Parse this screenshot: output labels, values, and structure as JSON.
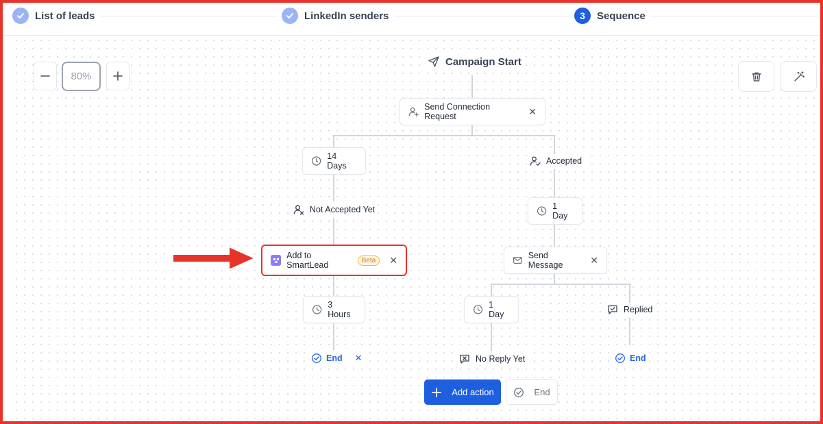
{
  "stepper": {
    "steps": [
      {
        "label": "List of leads",
        "state": "done"
      },
      {
        "label": "LinkedIn senders",
        "state": "done"
      },
      {
        "label": "Sequence",
        "number": "3",
        "state": "active"
      }
    ]
  },
  "zoom": {
    "minus": "−",
    "value": "80%",
    "plus": "+"
  },
  "toolbar": {
    "delete_icon": "trash-icon",
    "magic_icon": "magic-wand-icon"
  },
  "flow": {
    "start": "Campaign Start",
    "send_connection_request": "Send Connection Request",
    "wait_14_days": "14 Days",
    "accepted": "Accepted",
    "not_accepted_yet": "Not Accepted Yet",
    "wait_1_day_a": "1 Day",
    "add_to_smartlead": "Add to SmartLead",
    "beta_badge": "Beta",
    "send_message": "Send Message",
    "wait_3_hours": "3 Hours",
    "wait_1_day_b": "1 Day",
    "replied": "Replied",
    "end_left": "End",
    "no_reply_yet": "No Reply Yet",
    "end_right": "End"
  },
  "actions": {
    "add_action": "Add action",
    "end": "End"
  },
  "colors": {
    "accent": "#1e5fe0",
    "highlight": "#e8332b",
    "end_link": "#2563eb"
  }
}
